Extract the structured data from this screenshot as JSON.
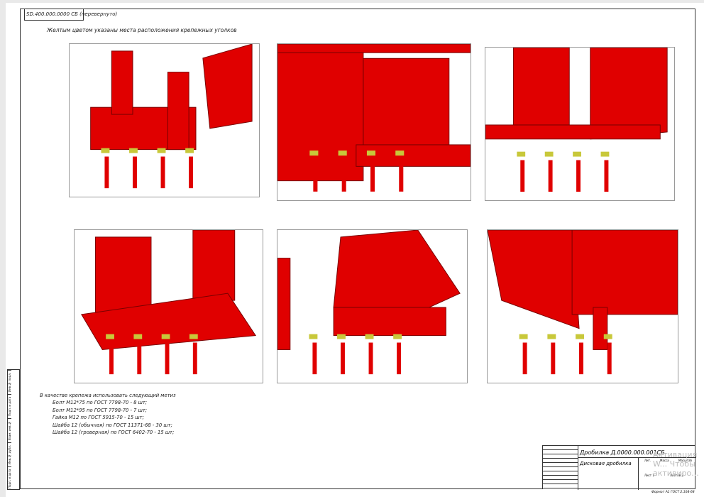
{
  "sheet": {
    "stamp": "SD.400.000.0000 СБ (перевернуто)",
    "note": "Желтым цветом указаны места расположения крепежных уголков",
    "fasteners": {
      "title": "В качестве крепежа использовать следующий метиз",
      "items": [
        "Болт М12*75 по ГОСТ 7798-70 - 8 шт;",
        "Болт М12*95 по ГОСТ 7798-70 - 7 шт;",
        "Гайка М12 по ГОСТ 5915-70      - 15 шт;",
        "Шайба 12 (обычная) по ГОСТ 11371-68 - 30 шт;",
        "Шайба 12 (гроверная) по ГОСТ 6402-70 - 15 шт;"
      ]
    },
    "title_block": {
      "code": "Дробилка Д.0000.000.001СБ",
      "name": "Дисковая дробилка",
      "lit": "Лит.",
      "mass": "Масса",
      "scale": "Масштаб",
      "sheet": "Лист 1",
      "sheets": "Листов 2",
      "format": "Формат  А1   ГОСТ 2.104-68"
    },
    "side_labels": [
      "Инв.№ подл.",
      "Подп. и дата",
      "Взам. инв.№",
      "Инв.№ дубл.",
      "Подп. и дата"
    ],
    "watermark": "Активация W... Чтобы активиро..."
  },
  "colors": {
    "machine": "#e00000",
    "highlight": "#c8c83a"
  }
}
